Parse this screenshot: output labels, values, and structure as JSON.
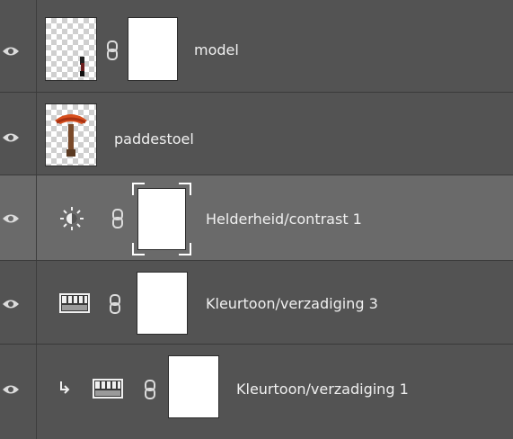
{
  "layers_panel": {
    "layers": [
      {
        "name": "model",
        "kind": "pixel",
        "has_mask": true,
        "mask_linked": true,
        "visible": true,
        "selected": false,
        "thumbnail_icon": "figure-on-transparent-icon"
      },
      {
        "name": "paddestoel",
        "kind": "pixel",
        "has_mask": false,
        "visible": true,
        "selected": false,
        "thumbnail_icon": "mushroom-thumbnail-icon"
      },
      {
        "name": "Helderheid/contrast 1",
        "kind": "adjustment",
        "adjustment_icon": "brightness-contrast-icon",
        "has_mask": true,
        "mask_linked": true,
        "visible": true,
        "selected": true
      },
      {
        "name": "Kleurtoon/verzadiging 3",
        "kind": "adjustment",
        "adjustment_icon": "hue-saturation-icon",
        "has_mask": true,
        "mask_linked": true,
        "visible": true,
        "selected": false
      },
      {
        "name": "Kleurtoon/verzadiging 1",
        "kind": "adjustment",
        "adjustment_icon": "hue-saturation-icon",
        "clipped": true,
        "has_mask": true,
        "mask_linked": true,
        "visible": true,
        "selected": false
      }
    ]
  },
  "colors": {
    "panel_bg": "#535353",
    "selected_row_bg": "#6a6a6a",
    "label_text": "#f0f0f0",
    "divider": "#3a3a3a"
  }
}
